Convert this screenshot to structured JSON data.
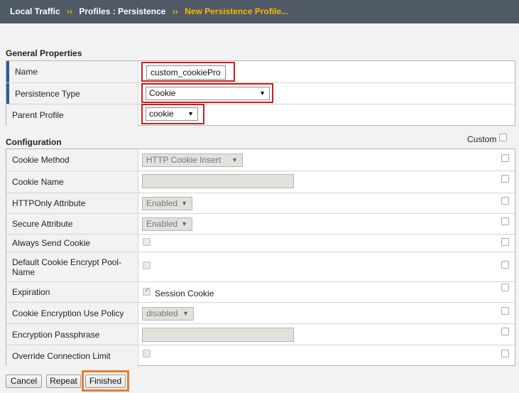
{
  "breadcrumb": {
    "root": "Local Traffic",
    "sep": "››",
    "middle": "Profiles : Persistence",
    "current": "New Persistence Profile..."
  },
  "general": {
    "title": "General Properties",
    "name_label": "Name",
    "name_value": "custom_cookiePro",
    "persistence_type_label": "Persistence Type",
    "persistence_type_value": "Cookie",
    "parent_profile_label": "Parent Profile",
    "parent_profile_value": "cookie"
  },
  "config": {
    "title": "Configuration",
    "custom_label": "Custom",
    "rows": [
      {
        "label": "Cookie Method",
        "value": "HTTP Cookie Insert"
      },
      {
        "label": "Cookie Name"
      },
      {
        "label": "HTTPOnly Attribute",
        "value": "Enabled"
      },
      {
        "label": "Secure Attribute",
        "value": "Enabled"
      },
      {
        "label": "Always Send Cookie"
      },
      {
        "label": "Default Cookie Encrypt Pool-Name"
      },
      {
        "label": "Expiration",
        "value": "Session Cookie"
      },
      {
        "label": "Cookie Encryption Use Policy",
        "value": "disabled"
      },
      {
        "label": "Encryption Passphrase"
      },
      {
        "label": "Override Connection Limit"
      }
    ]
  },
  "buttons": {
    "cancel": "Cancel",
    "repeat": "Repeat",
    "finished": "Finished"
  },
  "icons": {
    "dropdown": "dropdown-arrow-icon",
    "checkbox": "checkbox-icon"
  },
  "colors": {
    "header_bg": "#505a66",
    "breadcrumb_current": "#f7b500",
    "highlight_red": "#d41a1a",
    "highlight_orange": "#e87d2c",
    "required_marker": "#2d5b9a"
  }
}
